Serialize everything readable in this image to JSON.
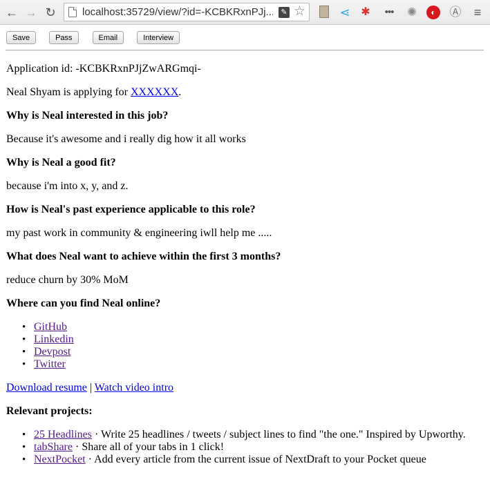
{
  "browser": {
    "url": "localhost:35729/view/?id=-KCBKRxnPJj...",
    "icons": {
      "back": "←",
      "forward": "→",
      "reload": "↻",
      "wrench": "✎",
      "star": "☆",
      "share": "⋖",
      "pin": "✱",
      "dots": "•••",
      "bug": "✺",
      "disc": "◐",
      "anarchy": "Ⓐ",
      "menu": "≡"
    }
  },
  "actions": {
    "save": "Save",
    "pass": "Pass",
    "email": "Email",
    "interview": "Interview"
  },
  "application": {
    "id_line": "Application id: -KCBKRxnPJjZwARGmqi-",
    "applicant_prefix": "Neal Shyam is applying for ",
    "job_link": "XXXXXX",
    "applicant_suffix": ".",
    "q1": "Why is Neal interested in this job?",
    "a1": "Because it's awesome and i really dig how it all works",
    "q2": "Why is Neal a good fit?",
    "a2": "because i'm into x, y, and z.",
    "q3": "How is Neal's past experience applicable to this role?",
    "a3": "my past work in community & engineering iwll help me .....",
    "q4": "What does Neal want to achieve within the first 3 months?",
    "a4": "reduce churn by 30% MoM",
    "q5": "Where can you find Neal online?",
    "links": [
      "GitHub",
      "Linkedin",
      "Devpost",
      "Twitter"
    ],
    "download_resume": "Download resume",
    "separator": " | ",
    "watch_video": "Watch video intro",
    "projects_heading": "Relevant projects:",
    "projects": [
      {
        "name": "25 Headlines",
        "desc": " · Write 25 headlines / tweets / subject lines to find \"the one.\" Inspired by Upworthy."
      },
      {
        "name": "tabShare",
        "desc": " · Share all of your tabs in 1 click!"
      },
      {
        "name": "NextPocket",
        "desc": " · Add every article from the current issue of NextDraft to your Pocket queue"
      }
    ]
  }
}
